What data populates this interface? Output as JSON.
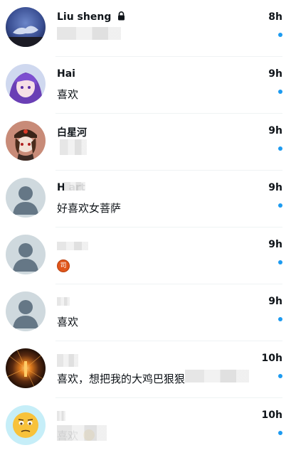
{
  "conversations": [
    {
      "name": "Liu sheng",
      "time": "8h",
      "message": "",
      "locked": true
    },
    {
      "name": "Hai",
      "time": "9h",
      "message": "喜欢"
    },
    {
      "name": "白星河",
      "time": "9h",
      "message": ""
    },
    {
      "name": "H   art",
      "time": "9h",
      "message": "好喜欢女菩萨"
    },
    {
      "name": "",
      "time": "9h",
      "message": "",
      "badge_text": "司"
    },
    {
      "name": "",
      "time": "9h",
      "message": "喜欢"
    },
    {
      "name": "",
      "time": "10h",
      "message": "喜欢，想把我的大鸡巴狠狠"
    },
    {
      "name": "",
      "time": "10h",
      "message": "喜欢"
    }
  ],
  "colors": {
    "unread_dot": "#1d9bf0",
    "separator": "#eff3f4",
    "text": "#0f1419"
  },
  "icons": {
    "lock": "lock-icon",
    "unread": "unread-dot-icon",
    "default_avatar": "default-avatar-icon"
  }
}
